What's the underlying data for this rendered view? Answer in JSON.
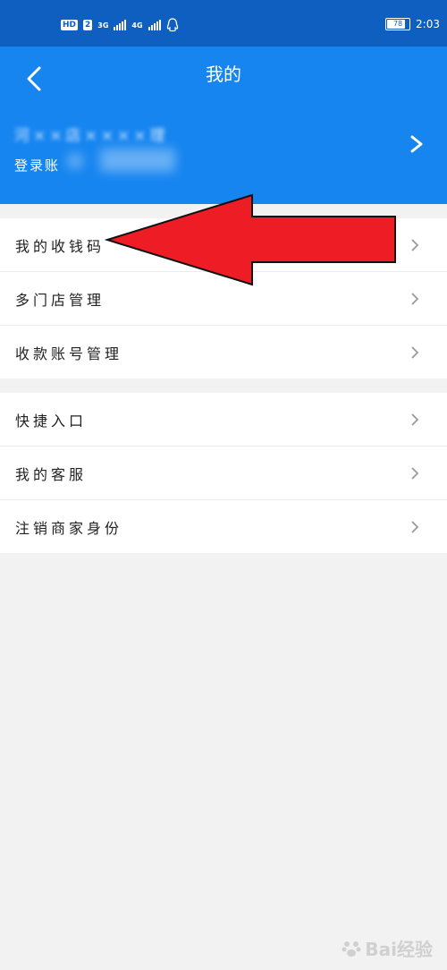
{
  "status_bar": {
    "network_badge": "HD",
    "sim_badge": "2",
    "net1": "3G",
    "net2": "4G",
    "battery": "78",
    "time": "2:03"
  },
  "header": {
    "title": "我的",
    "profile_name": "河××店××××理",
    "account_label": "登录账"
  },
  "section1": [
    {
      "label": "我的收钱码"
    },
    {
      "label": "多门店管理"
    },
    {
      "label": "收款账号管理"
    }
  ],
  "section2": [
    {
      "label": "快捷入口"
    },
    {
      "label": "我的客服"
    },
    {
      "label": "注销商家身份"
    }
  ],
  "watermark": "Bai经验",
  "colors": {
    "header": "#1685f0",
    "status_bar": "#0f5fc0",
    "arrow": "#ee1c25",
    "background": "#f2f2f2"
  }
}
